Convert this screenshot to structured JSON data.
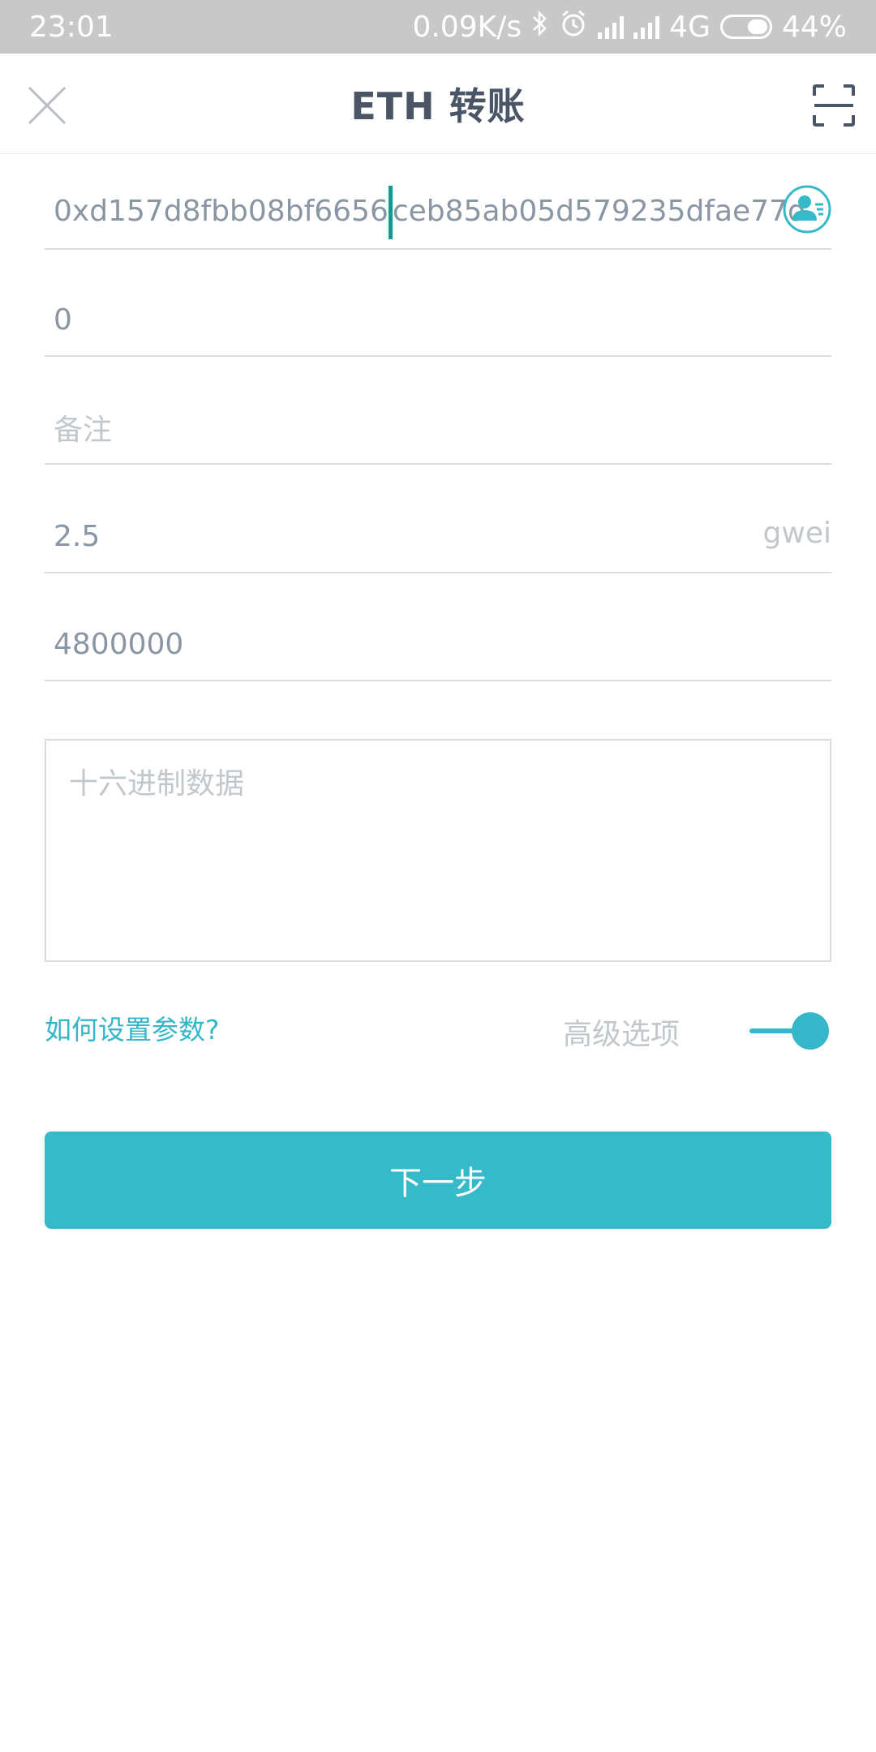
{
  "status_bar": {
    "time": "23:01",
    "net_speed": "0.09K/s",
    "network": "4G",
    "battery": "44%",
    "icons": [
      "bluetooth-icon",
      "alarm-icon",
      "signal-icon",
      "hd-signal-icon",
      "battery-icon"
    ]
  },
  "header": {
    "title": "ETH 转账",
    "close_icon": "close-icon",
    "scan_icon": "scan-icon"
  },
  "form": {
    "address_before_cursor": "0xd157d8fbb08bf6656",
    "address_after_cursor": "ceb85ab05d579235dfae77d",
    "amount": "0",
    "memo_placeholder": "备注",
    "gas_price": "2.5",
    "gas_unit": "gwei",
    "gas_limit": "4800000",
    "hex_placeholder": "十六进制数据"
  },
  "options": {
    "help_link": "如何设置参数?",
    "advanced_label": "高级选项",
    "advanced_on": true
  },
  "actions": {
    "next_label": "下一步"
  },
  "colors": {
    "accent": "#36b9c8",
    "status_bar_bg": "#c8c8c8",
    "title": "#4a5565",
    "cursor": "#129a91"
  }
}
